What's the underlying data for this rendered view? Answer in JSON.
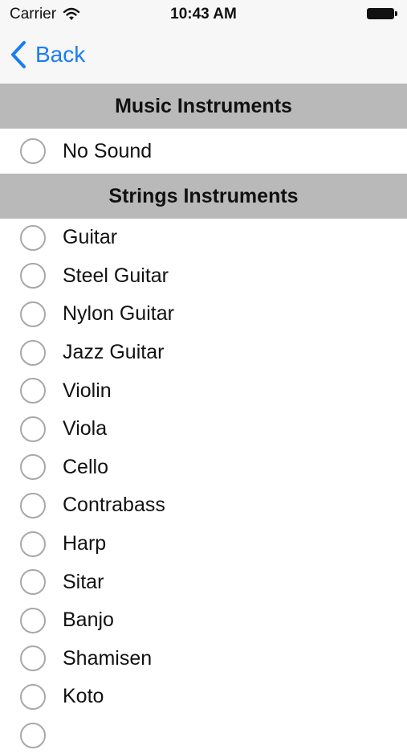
{
  "status_bar": {
    "carrier": "Carrier",
    "time": "10:43 AM"
  },
  "nav": {
    "back_label": "Back",
    "accent_color": "#1a7cf5"
  },
  "sections": [
    {
      "title": "Music Instruments",
      "items": [
        "No Sound"
      ]
    },
    {
      "title": "Strings Instruments",
      "items": [
        "Guitar",
        "Steel Guitar",
        "Nylon Guitar",
        "Jazz Guitar",
        "Violin",
        "Viola",
        "Cello",
        "Contrabass",
        "Harp",
        "Sitar",
        "Banjo",
        "Shamisen",
        "Koto"
      ]
    }
  ],
  "icons": {
    "wifi": "wifi-icon",
    "battery": "battery-icon",
    "back": "chevron-left-icon",
    "radio": "radio-unselected-icon"
  }
}
